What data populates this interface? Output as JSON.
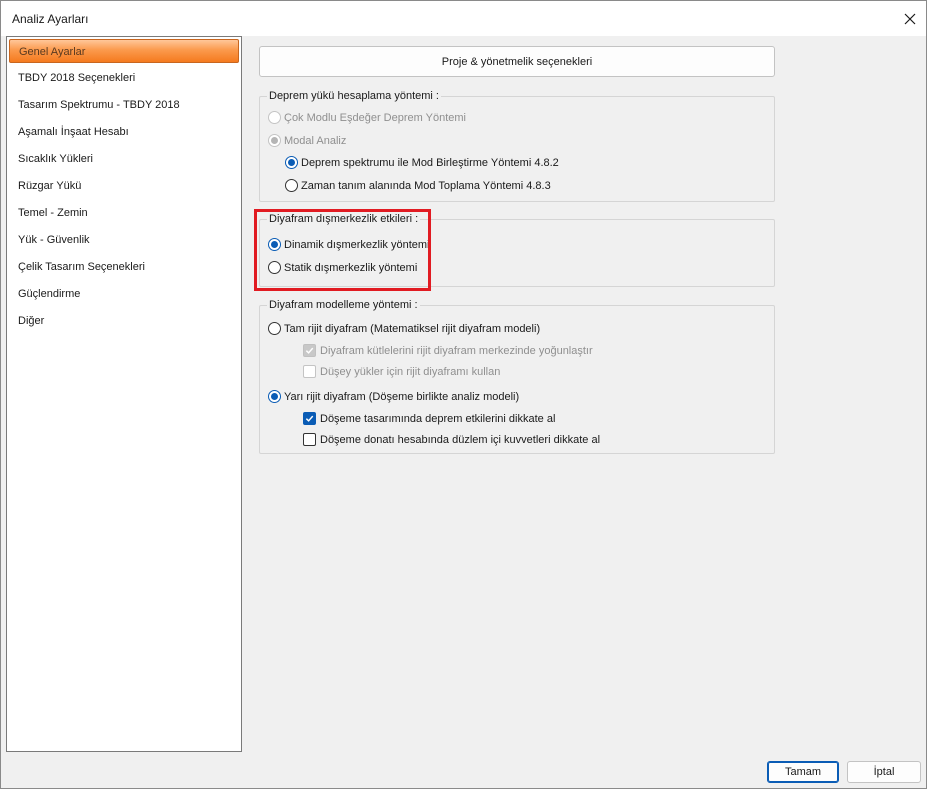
{
  "window": {
    "title": "Analiz Ayarları"
  },
  "nav": {
    "items": [
      {
        "label": "Genel Ayarlar",
        "selected": true
      },
      {
        "label": "TBDY 2018 Seçenekleri"
      },
      {
        "label": "Tasarım Spektrumu - TBDY 2018"
      },
      {
        "label": "Aşamalı İnşaat Hesabı"
      },
      {
        "label": "Sıcaklık Yükleri"
      },
      {
        "label": "Rüzgar Yükü"
      },
      {
        "label": "Temel - Zemin"
      },
      {
        "label": "Yük - Güvenlik"
      },
      {
        "label": "Çelik Tasarım Seçenekleri"
      },
      {
        "label": "Güçlendirme"
      },
      {
        "label": "Diğer"
      }
    ]
  },
  "content": {
    "project_button": "Proje & yönetmelik seçenekleri",
    "seismic": {
      "legend": "Deprem yükü hesaplama yöntemi :",
      "opt_esdeger": "Çok Modlu Eşdeğer Deprem Yöntemi",
      "opt_modal": "Modal Analiz",
      "opt_spektrum": "Deprem spektrumu ile Mod Birleştirme Yöntemi 4.8.2",
      "opt_zaman": "Zaman tanım alanında Mod Toplama Yöntemi 4.8.3"
    },
    "eccentricity": {
      "legend": "Diyafram dışmerkezlik etkileri :",
      "opt_dinamik": "Dinamik dışmerkezlik yöntemi",
      "opt_statik": "Statik dışmerkezlik yöntemi"
    },
    "diaphragm": {
      "legend": "Diyafram modelleme yöntemi  :",
      "opt_tam": "Tam rijit diyafram (Matematiksel rijit diyafram modeli)",
      "chk_kutle": "Diyafram kütlelerini rijit diyafram merkezinde yoğunlaştır",
      "chk_dusey": "Düşey yükler için rijit diyaframı kullan",
      "opt_yari": "Yarı rijit diyafram (Döşeme birlikte analiz modeli)",
      "chk_doseme_deprem": "Döşeme tasarımında deprem etkilerini dikkate al",
      "chk_doseme_donati": "Döşeme donatı hesabında düzlem içi kuvvetleri dikkate al"
    }
  },
  "footer": {
    "ok": "Tamam",
    "cancel": "İptal"
  },
  "colors": {
    "accent": "#0a5cb5",
    "highlight": "#e11b22",
    "nav_selected": "#f57a1e"
  },
  "icons": {
    "close": "close-icon",
    "check": "check-mark-icon"
  }
}
